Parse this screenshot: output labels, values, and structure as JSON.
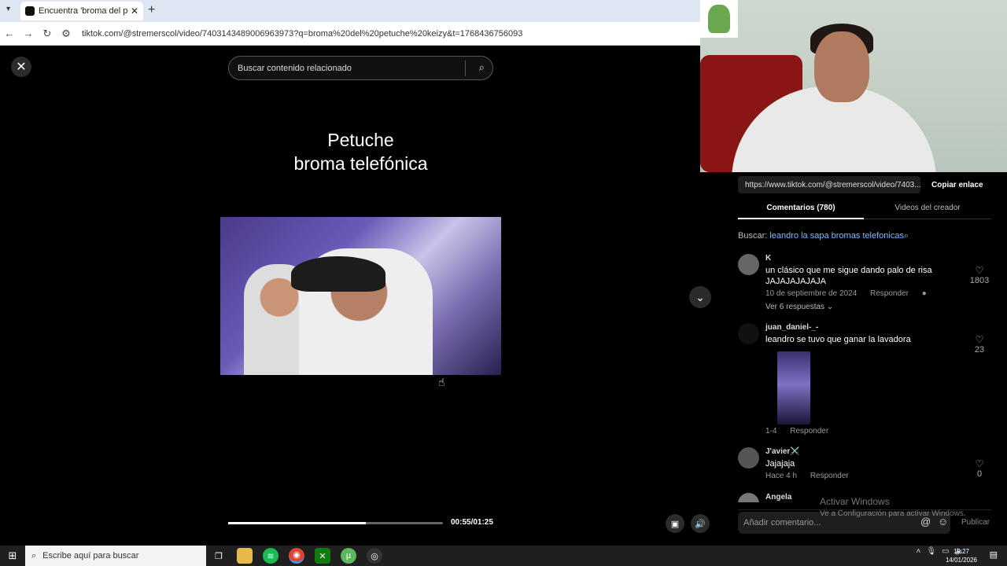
{
  "browser": {
    "tab_title": "Encuentra 'broma del petu",
    "tab_close": "✕",
    "new_tab": "+",
    "url": "tiktok.com/@stremerscol/video/7403143489006963973?q=broma%20del%20petuche%20keizy&t=1768436756093"
  },
  "player": {
    "search_placeholder": "Buscar contenido relacionado",
    "caption_line1": "Petuche",
    "caption_line2": "broma telefónica",
    "progress": 0.64,
    "time": "00:55/01:25"
  },
  "panel": {
    "link": "https://www.tiktok.com/@stremerscol/video/7403...",
    "copy_label": "Copiar enlace",
    "tab_comments": "Comentarios (780)",
    "tab_creator": "Videos del creador",
    "search_label": "Buscar:",
    "search_query": "leandro la sapa bromas telefonicas",
    "comments": [
      {
        "user": "K",
        "text": "un clásico que me sigue dando palo de risa JAJAJAJAJAJA",
        "date": "10 de septiembre de 2024",
        "reply": "Responder",
        "likes": "1803",
        "replies": "Ver 6 respuestas"
      },
      {
        "user": "juan_daniel-_-",
        "text": "leandro se tuvo que ganar la lavadora",
        "date": "1-4",
        "reply": "Responder",
        "likes": "23"
      },
      {
        "user": "J'avier⚔️",
        "text": "Jajajaja",
        "date": "Hace 4 h",
        "reply": "Responder",
        "likes": "0"
      },
      {
        "user": "Ángela"
      }
    ],
    "compose_placeholder": "Añadir comentario...",
    "publish": "Publicar"
  },
  "watermark": {
    "title": "Activar Windows",
    "subtitle": "Ve a Configuración para activar Windows."
  },
  "taskbar": {
    "search_placeholder": "Escribe aquí para buscar",
    "time": "19:27",
    "date": "14/01/2026"
  }
}
